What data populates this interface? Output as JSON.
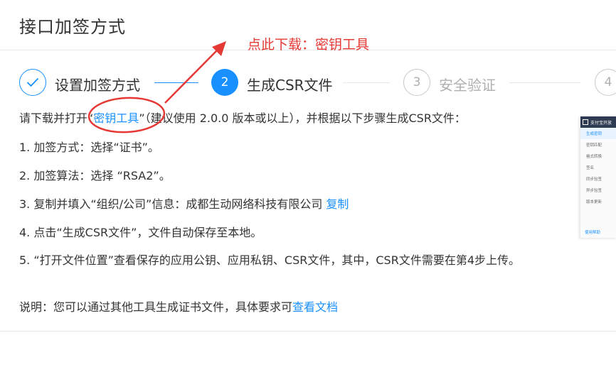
{
  "page_title": "接口加签方式",
  "annotation": "点此下载：密钥工具",
  "steps": [
    {
      "number": "",
      "label": "设置加签方式",
      "state": "done"
    },
    {
      "number": "2",
      "label": "生成CSR文件",
      "state": "active"
    },
    {
      "number": "3",
      "label": "安全验证",
      "state": "wait"
    },
    {
      "number": "4",
      "label": "",
      "state": "wait"
    }
  ],
  "intro": {
    "prefix": "请下载并打开“",
    "link": "密钥工具",
    "suffix": "”（建议使用 2.0.0 版本或以上），并根据以下步骤生成CSR文件："
  },
  "instructions": {
    "i1": "1. 加签方式：选择“证书”。",
    "i2": "2. 加签算法：选择 “RSA2”。",
    "i3_text": "3. 复制并填入“组织/公司”信息：成都生动网络科技有限公司 ",
    "i3_link": "复制",
    "i4": "4. 点击“生成CSR文件”，文件自动保存至本地。",
    "i5": "5. “打开文件位置”查看保存的应用公钥、应用私钥、CSR文件，其中，CSR文件需要在第4步上传。"
  },
  "note": {
    "text": "说明：您可以通过其他工具生成证书文件，具体要求可",
    "link": "查看文档"
  },
  "thumbnail": {
    "header": "支付宝开放",
    "items": [
      "生成密钥",
      "密钥匹配",
      "格式转换",
      "签名",
      "同步验签",
      "异步验签",
      "版本更新"
    ],
    "footer": "使用帮助"
  },
  "colors": {
    "accent": "#1890ff",
    "annotation": "#e53935"
  }
}
